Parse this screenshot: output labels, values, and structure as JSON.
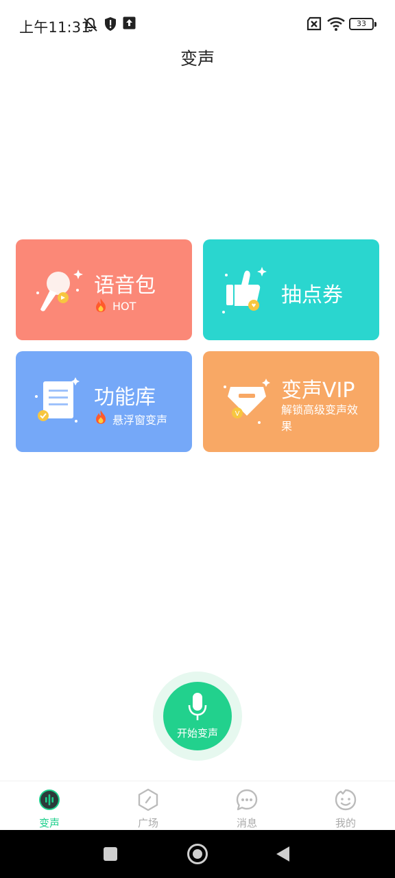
{
  "status_bar": {
    "time": "上午11:31",
    "battery": "33",
    "icons": [
      "bell-off-icon",
      "shield-alert-icon",
      "upload-icon",
      "sim-off-icon",
      "wifi-icon",
      "battery-icon"
    ]
  },
  "page": {
    "title": "变声"
  },
  "cards": [
    {
      "title": "语音包",
      "sub": "HOT",
      "color": "#fb8877",
      "icon": "microphone-icon",
      "sub_icon": "fire-icon"
    },
    {
      "title": "抽点券",
      "sub": "",
      "color": "#2ad6cf",
      "icon": "thumbs-up-icon"
    },
    {
      "title": "功能库",
      "sub": "悬浮窗变声",
      "color": "#75a8f8",
      "icon": "document-icon",
      "sub_icon": "fire-icon"
    },
    {
      "title": "变声VIP",
      "sub": "解锁高级变声效果",
      "color": "#f8a865",
      "icon": "vip-gem-icon"
    }
  ],
  "start_button": {
    "label": "开始变声",
    "icon": "mic-icon"
  },
  "bottom_nav": [
    {
      "label": "变声",
      "active": true,
      "icon": "voice-wave-icon"
    },
    {
      "label": "广场",
      "active": false,
      "icon": "compass-icon"
    },
    {
      "label": "消息",
      "active": false,
      "icon": "chat-icon"
    },
    {
      "label": "我的",
      "active": false,
      "icon": "smiley-icon"
    }
  ],
  "system_nav": [
    "recents-button",
    "home-button",
    "back-button"
  ]
}
